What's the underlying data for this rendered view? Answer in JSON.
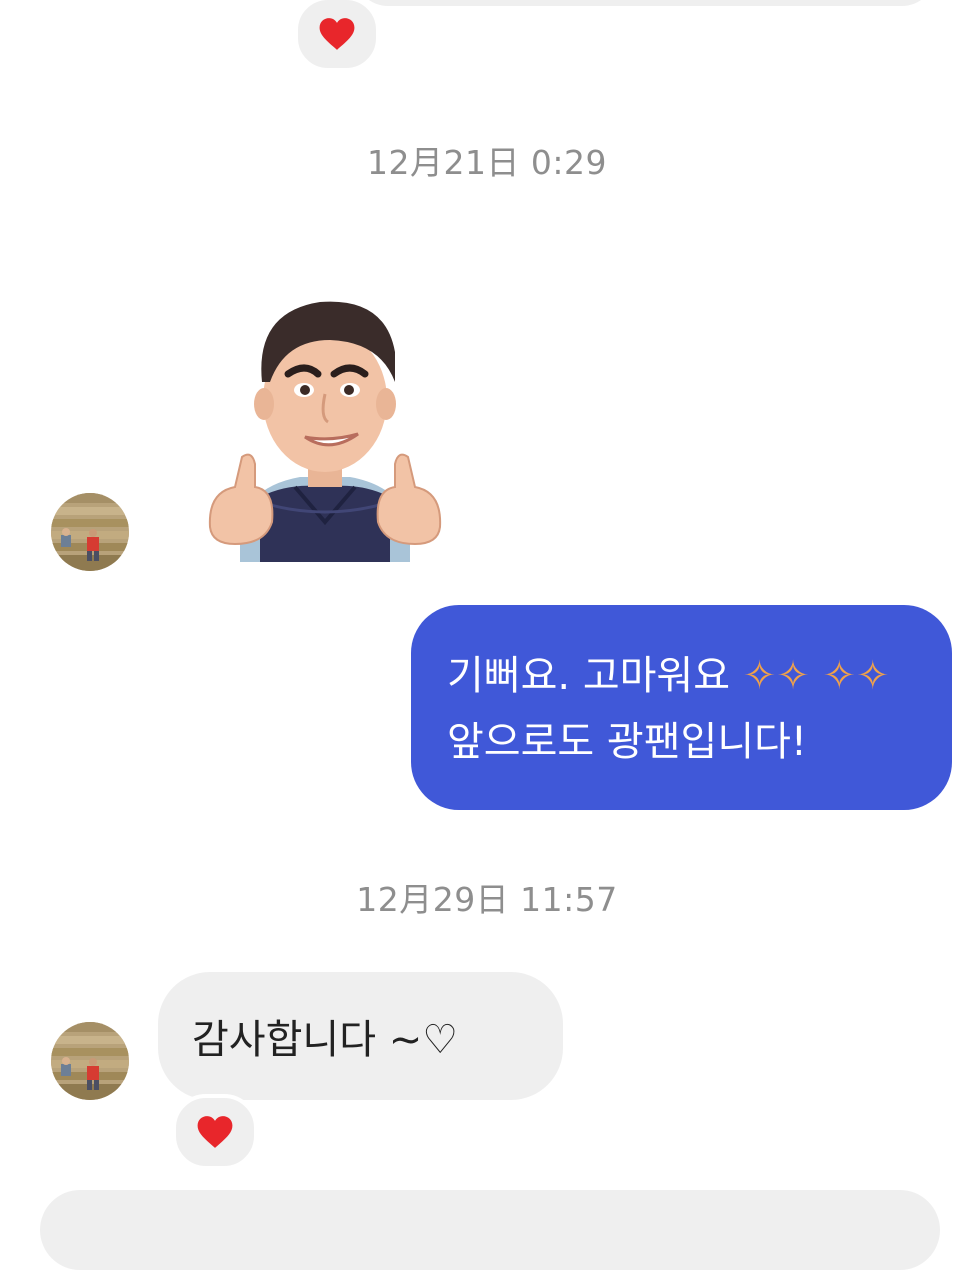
{
  "messages": {
    "timestamp_1": "12月21日 0:29",
    "timestamp_2": "12月29日 11:57",
    "sent_line_1": "기뻐요. 고마워요 ",
    "sent_sparkles": "✧✧ ✧✧",
    "sent_line_2": "앞으로도 광팬입니다!",
    "received_text": "감사합니다 ~♡"
  },
  "icons": {
    "reaction": "heart-icon",
    "sticker": "thumbs-up-avatar-sticker",
    "avatar": "profile-avatar"
  },
  "colors": {
    "sent_bubble": "#4058d8",
    "received_bubble": "#efefef",
    "heart": "#e8262b",
    "timestamp": "#8e8e8e"
  }
}
